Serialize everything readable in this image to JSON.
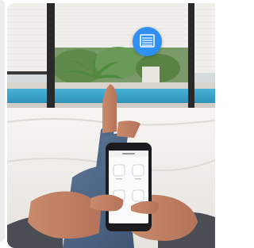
{
  "photo": {
    "description_icon": "window-shade-icon",
    "accent": "#2f8ff2"
  },
  "phone_app": {
    "header_label": "",
    "tiles": 4
  }
}
